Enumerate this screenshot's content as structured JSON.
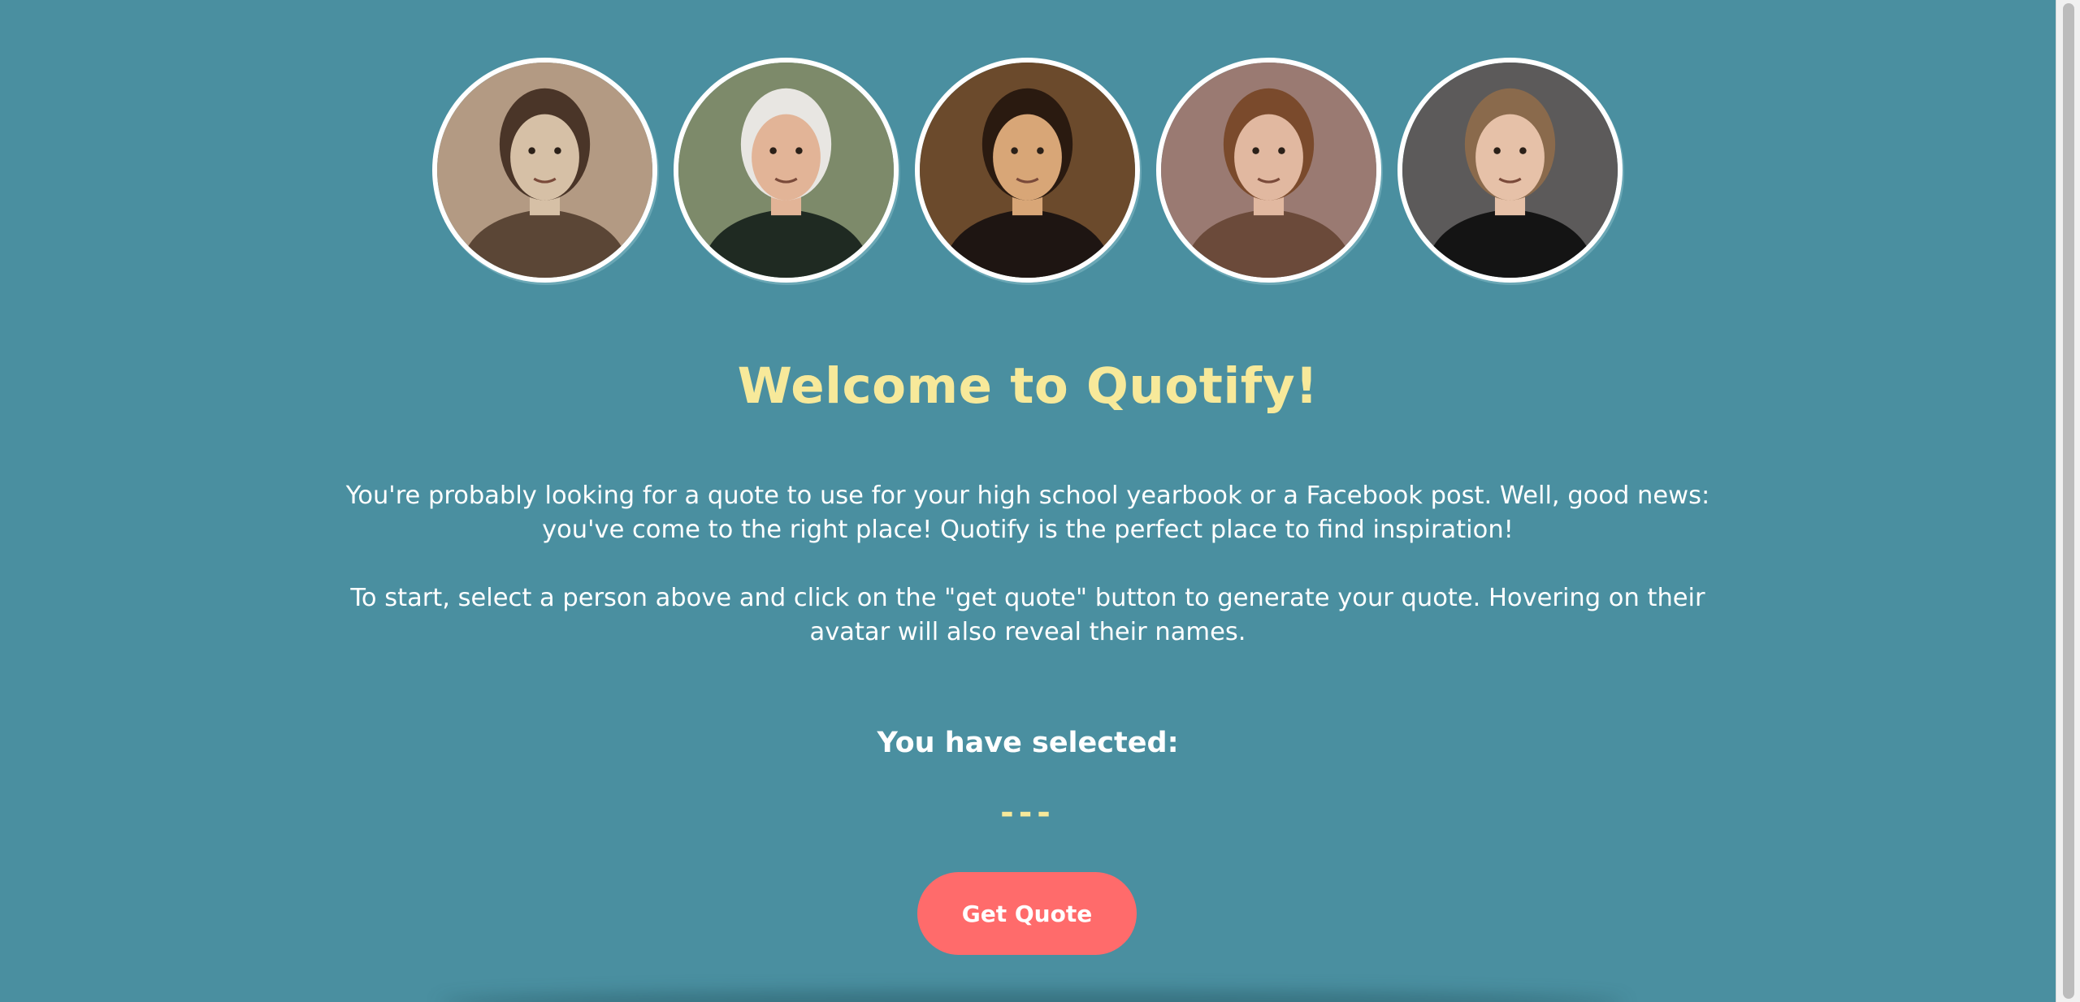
{
  "avatars": [
    {
      "label": "avatar-1",
      "bg": "#b39a83",
      "skin": "#d6c0a6",
      "hair": "#4a3528",
      "clothes": "#5b4636"
    },
    {
      "label": "avatar-2",
      "bg": "#7d8a6a",
      "skin": "#e2b497",
      "hair": "#e8e6e2",
      "clothes": "#1f2a22"
    },
    {
      "label": "avatar-3",
      "bg": "#6b4a2c",
      "skin": "#d8a677",
      "hair": "#2a1a10",
      "clothes": "#1e1512"
    },
    {
      "label": "avatar-4",
      "bg": "#9a7a72",
      "skin": "#e1b8a0",
      "hair": "#7a4a2c",
      "clothes": "#6b4a3a"
    },
    {
      "label": "avatar-5",
      "bg": "#5c5a5a",
      "skin": "#e6c1a8",
      "hair": "#8a6a4c",
      "clothes": "#141414"
    }
  ],
  "title": "Welcome to Quotify!",
  "intro": {
    "p1": "You're probably looking for a quote to use for your high school yearbook or a Facebook post. Well, good news: you've come to the right place! Quotify is the perfect place to find inspiration!",
    "p2": "To start, select a person above and click on the \"get quote\" button to generate your quote. Hovering on their avatar will also reveal their names."
  },
  "selection": {
    "label": "You have selected:",
    "value": "---"
  },
  "button": {
    "label": "Get Quote"
  },
  "colors": {
    "background": "#4a8fa0",
    "title": "#f7e99a",
    "button": "#ff6b6b"
  }
}
